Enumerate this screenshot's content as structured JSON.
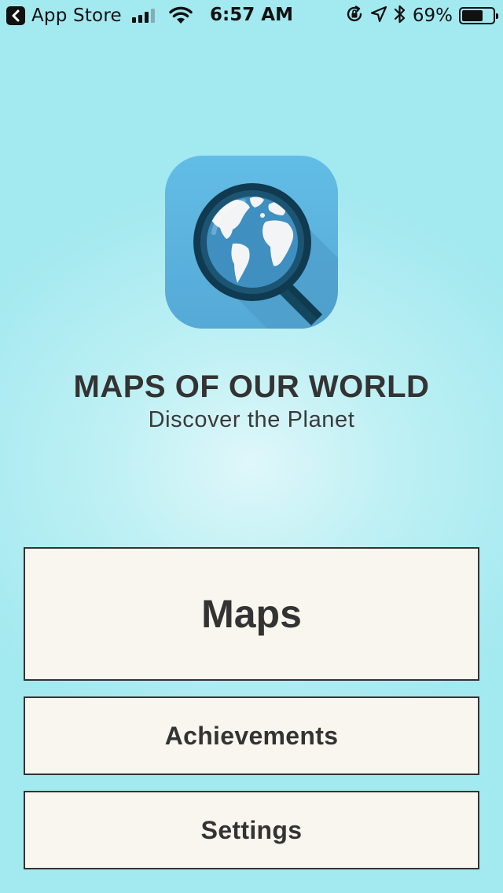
{
  "status_bar": {
    "back_app_label": "App Store",
    "time": "6:57 AM",
    "battery_percent": "69%",
    "battery_level": 0.69,
    "icons": [
      "back-chevron-icon",
      "signal-icon",
      "wifi-icon",
      "rotation-lock-icon",
      "location-arrow-icon",
      "bluetooth-icon",
      "battery-icon"
    ]
  },
  "app": {
    "title": "MAPS OF OUR WORLD",
    "subtitle": "Discover the Planet",
    "icon": "globe-magnifier-icon"
  },
  "menu": {
    "maps_label": "Maps",
    "achievements_label": "Achievements",
    "settings_label": "Settings"
  },
  "colors": {
    "background": "#a3e9f0",
    "button_fill": "#f9f6ef",
    "button_border": "#333333",
    "text": "#333333",
    "icon_blue": "#5db4e0"
  }
}
